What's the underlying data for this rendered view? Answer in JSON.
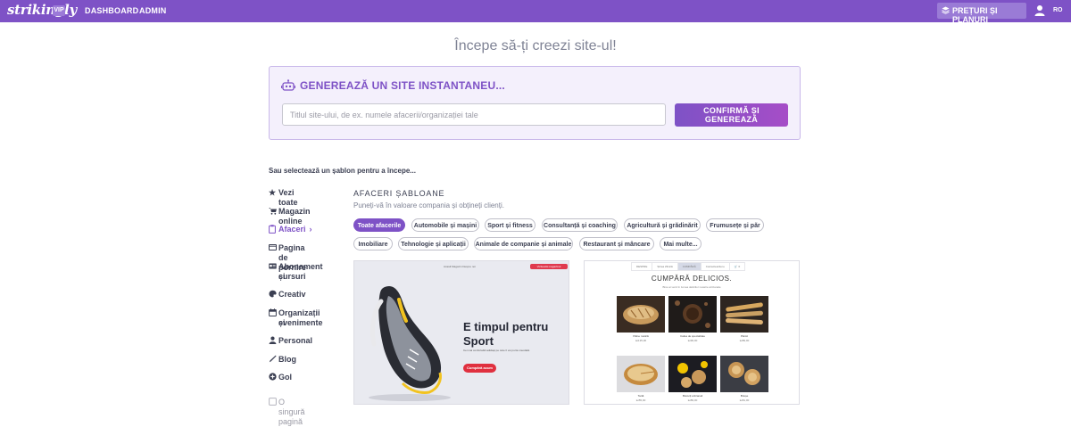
{
  "topbar": {
    "logo": "strikingly",
    "vip_badge": "VIP",
    "nav": [
      "DASHBOARD",
      "ADMIN"
    ],
    "pricing_button": "PREȚURI ȘI PLANURI",
    "language": "RO",
    "bar_color": "#7e52c6"
  },
  "page_title": "Începe să-ți creezi site-ul!",
  "generator": {
    "title": "GENEREAZĂ UN SITE INSTANTANEU...",
    "input_placeholder": "Titlul site-ului, de ex. numele afacerii/organizației tale",
    "input_value": "",
    "button": "CONFIRMĂ ȘI GENEREAZĂ",
    "icon": "robot-icon"
  },
  "or_select": "Sau selectează un șablon pentru a începe...",
  "sidebar": {
    "items": [
      {
        "label": "Vezi toate",
        "icon": "star-icon"
      },
      {
        "label": "Magazin online",
        "icon": "cart-icon"
      },
      {
        "label": "Afaceri",
        "icon": "clipboard-icon"
      },
      {
        "label": "Pagina de pornire",
        "icon": "laptop-icon"
      },
      {
        "label": "Abonament și",
        "label2": "cursuri",
        "icon": "id-card-icon"
      },
      {
        "label": "Creativ",
        "icon": "palette-icon"
      },
      {
        "label": "Organizații și",
        "label2": "evenimente",
        "icon": "calendar-icon"
      },
      {
        "label": "Personal",
        "icon": "person-icon"
      },
      {
        "label": "Blog",
        "icon": "pen-icon"
      },
      {
        "label": "Gol",
        "icon": "plus-circle-icon"
      },
      {
        "label": "O singură pagină",
        "icon": "checkbox-icon"
      }
    ],
    "active_index": 2
  },
  "templates": {
    "title": "AFACERI ȘABLOANE",
    "subtitle": "Puneți-vă în valoare compania și obțineți clienți.",
    "chips": [
      "Toate afacerile",
      "Automobile și mașini",
      "Sport și fitness",
      "Consultanță și coaching",
      "Agricultură și grădinărit",
      "Frumusețe și păr",
      "Imobiliare",
      "Tehnologie și aplicații",
      "Animale de companie și animale",
      "Restaurant și mâncare",
      "Mai multe..."
    ],
    "selected_chip": 0,
    "card1": {
      "nav": "Acasă   Magazin   Despre noi",
      "cta": "Vizitează magazinul",
      "headline1": "E timpul pentru",
      "headline2": "Sport",
      "desc": "Cei mai confortabili adidași pe care îi vei purta vreodată.",
      "button": "Cumpără acum"
    },
    "card2": {
      "tabs": [
        "DESPRE",
        "Știrea Zilnică",
        "CUMPĂRĂ",
        "Contactează-ne",
        "🛒 0"
      ],
      "active_tab": 2,
      "heading": "CUMPĂRĂ DELICIOS.",
      "subheading": "Bine ai venit în lumea deliciilor noastre artizanale",
      "products": [
        {
          "name": "Pâine rustică",
          "price": "lei135,00"
        },
        {
          "name": "Cafea de specialitate",
          "price": "lei99,00"
        },
        {
          "name": "Pânici",
          "price": "lei89,00"
        },
        {
          "name": "Tartă",
          "price": "lei55,00"
        },
        {
          "name": "Biscuiți artizanali",
          "price": "lei89,00"
        },
        {
          "name": "Brioșe",
          "price": "lei81,00"
        }
      ]
    }
  }
}
